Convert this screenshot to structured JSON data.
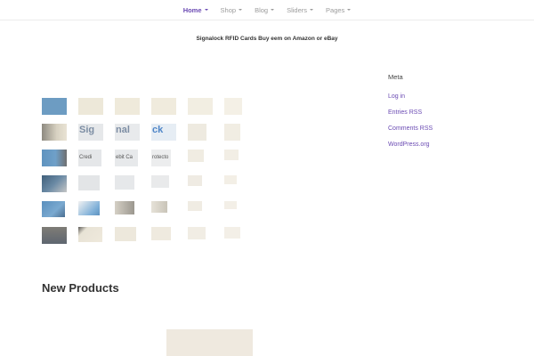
{
  "nav": {
    "items": [
      {
        "label": "Home",
        "active": true
      },
      {
        "label": "Shop",
        "active": false
      },
      {
        "label": "Blog",
        "active": false
      },
      {
        "label": "Sliders",
        "active": false
      },
      {
        "label": "Pages",
        "active": false
      }
    ]
  },
  "slider": {
    "caption": "Signalock RFID Cards Buy eem on Amazon or eBay",
    "tile_text": {
      "r1c2": "Sig",
      "r1c3": "nal",
      "r1c4": "ck",
      "r2c1": "Credi",
      "r2c2": "ebit Ca",
      "r2c3": "rotecto"
    }
  },
  "sidebar": {
    "title": "Meta",
    "links": [
      "Log in",
      "Entries RSS",
      "Comments RSS",
      "WordPress.org"
    ]
  },
  "main": {
    "section_title": "New Products"
  },
  "colors": {
    "accent": "#6b4bb3",
    "nav_inactive": "#9c9c9c"
  }
}
